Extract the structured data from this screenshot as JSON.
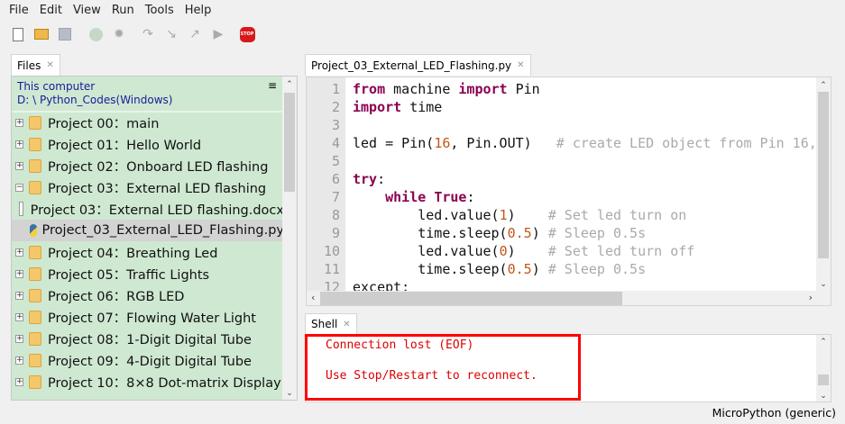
{
  "menu": [
    "File",
    "Edit",
    "View",
    "Run",
    "Tools",
    "Help"
  ],
  "toolbar": {
    "stop_label": "STOP"
  },
  "files": {
    "tab_label": "Files",
    "header_line1": "This computer",
    "header_line2": "D: \\ Python_Codes(Windows)",
    "menu_glyph": "≡",
    "items": [
      {
        "label": "Project 00：main",
        "type": "folder",
        "expanded": false
      },
      {
        "label": "Project 01：Hello World",
        "type": "folder",
        "expanded": false
      },
      {
        "label": "Project 02：Onboard LED flashing",
        "type": "folder",
        "expanded": false
      },
      {
        "label": "Project 03：External LED flashing",
        "type": "folder",
        "expanded": true
      },
      {
        "label": "Project 03：External LED flashing.docx",
        "type": "file",
        "expanded": false
      },
      {
        "label": "Project_03_External_LED_Flashing.py",
        "type": "python",
        "expanded": false,
        "selected": true
      },
      {
        "label": "Project 04：Breathing Led",
        "type": "folder",
        "expanded": false
      },
      {
        "label": "Project 05：Traffic Lights",
        "type": "folder",
        "expanded": false
      },
      {
        "label": "Project 06：RGB LED",
        "type": "folder",
        "expanded": false
      },
      {
        "label": "Project 07：Flowing Water Light",
        "type": "folder",
        "expanded": false
      },
      {
        "label": "Project 08：1-Digit Digital Tube",
        "type": "folder",
        "expanded": false
      },
      {
        "label": "Project 09：4-Digit Digital Tube",
        "type": "folder",
        "expanded": false
      },
      {
        "label": "Project 10：8×8 Dot-matrix Display",
        "type": "folder",
        "expanded": false
      }
    ]
  },
  "editor": {
    "tab_label": "Project_03_External_LED_Flashing.py",
    "lines": [
      [
        [
          "from",
          "kw"
        ],
        [
          " machine ",
          ""
        ],
        [
          "import",
          "kw"
        ],
        [
          " Pin",
          ""
        ]
      ],
      [
        [
          "import",
          "kw"
        ],
        [
          " time",
          ""
        ]
      ],
      [],
      [
        [
          "led = Pin(",
          ""
        ],
        [
          "16",
          "num"
        ],
        [
          ", Pin.OUT)   ",
          ""
        ],
        [
          "# create LED object from Pin 16,",
          "cm"
        ]
      ],
      [],
      [
        [
          "try",
          "kw"
        ],
        [
          ":",
          ""
        ]
      ],
      [
        [
          "    ",
          ""
        ],
        [
          "while",
          "kw"
        ],
        [
          " ",
          ""
        ],
        [
          "True",
          "kw"
        ],
        [
          ":",
          ""
        ]
      ],
      [
        [
          "        led.value(",
          ""
        ],
        [
          "1",
          "num"
        ],
        [
          ")    ",
          ""
        ],
        [
          "# Set led turn on",
          "cm"
        ]
      ],
      [
        [
          "        time.sleep(",
          ""
        ],
        [
          "0.5",
          "num"
        ],
        [
          ") ",
          ""
        ],
        [
          "# Sleep 0.5s",
          "cm"
        ]
      ],
      [
        [
          "        led.value(",
          ""
        ],
        [
          "0",
          "num"
        ],
        [
          ")    ",
          ""
        ],
        [
          "# Set led turn off",
          "cm"
        ]
      ],
      [
        [
          "        time.sleep(",
          ""
        ],
        [
          "0.5",
          "num"
        ],
        [
          ") ",
          ""
        ],
        [
          "# Sleep 0.5s",
          "cm"
        ]
      ],
      [
        [
          "except:",
          ""
        ]
      ]
    ]
  },
  "shell": {
    "tab_label": "Shell",
    "line1": "Connection lost (EOF)",
    "line2": "Use Stop/Restart to reconnect."
  },
  "status": {
    "interpreter": "MicroPython (generic)"
  }
}
